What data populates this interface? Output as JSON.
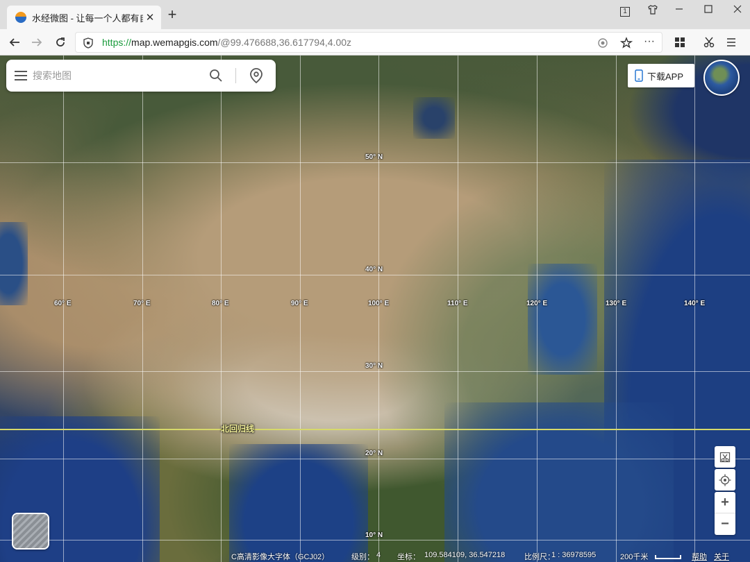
{
  "browser": {
    "tab_title": "水经微图 - 让每一个人都有自",
    "url_scheme": "https://",
    "url_host": "map.wemapgis.com",
    "url_rest": "/@99.476688,36.617794,4.00z",
    "window_badge": "1"
  },
  "search": {
    "placeholder": "搜索地图"
  },
  "download_label": "下载APP",
  "graticule": {
    "lon_labels": [
      "60° E",
      "70° E",
      "80° E",
      "90° E",
      "100° E",
      "110° E",
      "120° E",
      "130° E",
      "140° E"
    ],
    "lat_labels": [
      "50° N",
      "40° N",
      "30° N",
      "20° N",
      "10° N"
    ],
    "tropic_label": "北回归线"
  },
  "status": {
    "layer": "C高清影像大字体（GCJ02）",
    "level_label": "级别：",
    "level": "4",
    "coord_label": "坐标：",
    "coord": "109.584109,  36.547218",
    "scale_label": "比例尺：",
    "scale": "1 : 36978595",
    "scale_bar": "200千米",
    "help": "帮助",
    "about": "关于"
  },
  "colors": {
    "url_scheme": "#1a9b3c",
    "tropic_line": "#d7d96a",
    "grid_line": "#ffffff"
  }
}
